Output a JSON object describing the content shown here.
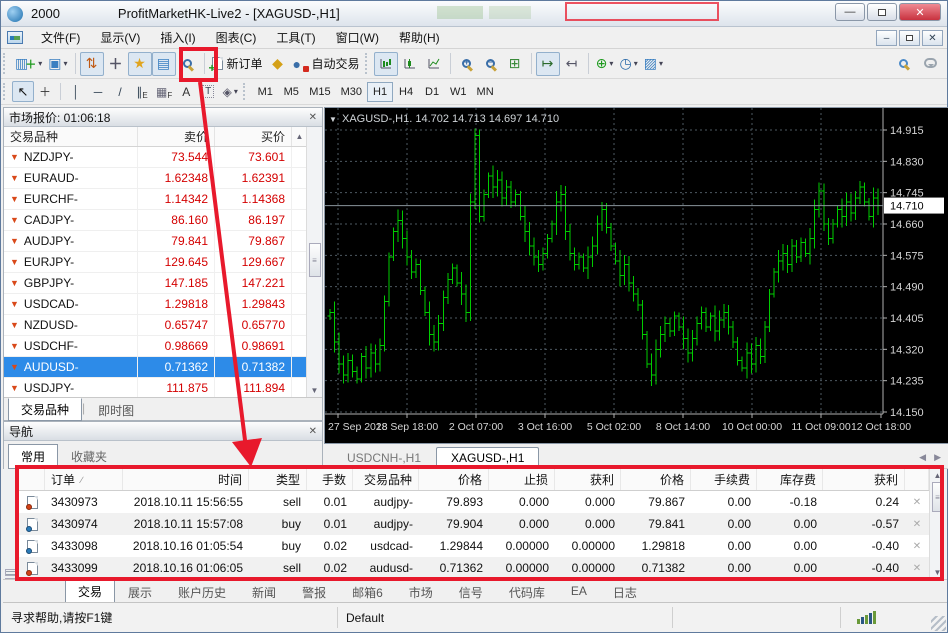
{
  "window": {
    "account": "2000",
    "title": "ProfitMarketHK-Live2 - [XAGUSD-,H1]"
  },
  "menu": {
    "items": [
      "文件(F)",
      "显示(V)",
      "插入(I)",
      "图表(C)",
      "工具(T)",
      "窗口(W)",
      "帮助(H)"
    ]
  },
  "toolbar": {
    "new_order_label": "新订单",
    "autotrading_label": "自动交易",
    "timeframes": [
      "M1",
      "M5",
      "M15",
      "M30",
      "H1",
      "H4",
      "D1",
      "W1",
      "MN"
    ],
    "active_timeframe": "H1"
  },
  "market_watch": {
    "title": "市场报价: 01:06:18",
    "columns": [
      "交易品种",
      "卖价",
      "买价"
    ],
    "rows": [
      {
        "symbol": "NZDJPY-",
        "bid": "73.544",
        "ask": "73.601"
      },
      {
        "symbol": "EURAUD-",
        "bid": "1.62348",
        "ask": "1.62391"
      },
      {
        "symbol": "EURCHF-",
        "bid": "1.14342",
        "ask": "1.14368"
      },
      {
        "symbol": "CADJPY-",
        "bid": "86.160",
        "ask": "86.197"
      },
      {
        "symbol": "AUDJPY-",
        "bid": "79.841",
        "ask": "79.867"
      },
      {
        "symbol": "EURJPY-",
        "bid": "129.645",
        "ask": "129.667"
      },
      {
        "symbol": "GBPJPY-",
        "bid": "147.185",
        "ask": "147.221"
      },
      {
        "symbol": "USDCAD-",
        "bid": "1.29818",
        "ask": "1.29843"
      },
      {
        "symbol": "NZDUSD-",
        "bid": "0.65747",
        "ask": "0.65770"
      },
      {
        "symbol": "USDCHF-",
        "bid": "0.98669",
        "ask": "0.98691"
      },
      {
        "symbol": "AUDUSD-",
        "bid": "0.71362",
        "ask": "0.71382",
        "selected": true
      },
      {
        "symbol": "USDJPY-",
        "bid": "111.875",
        "ask": "111.894"
      }
    ],
    "tabs": [
      "交易品种",
      "即时图"
    ],
    "active_tab": "交易品种"
  },
  "navigator": {
    "title": "导航",
    "tabs": [
      "常用",
      "收藏夹"
    ],
    "active_tab": "常用"
  },
  "chart_tabs": {
    "tabs": [
      "USDCNH-,H1",
      "XAGUSD-,H1"
    ],
    "active": "XAGUSD-,H1"
  },
  "chart_data": {
    "type": "bar",
    "symbol": "XAGUSD-",
    "timeframe": "H1",
    "header": "XAGUSD-,H1. 14.702 14.713 14.697 14.710",
    "current_bar": {
      "open": 14.702,
      "high": 14.713,
      "low": 14.697,
      "close": 14.71
    },
    "current_price": 14.71,
    "current_price_label": "14.710",
    "y_ticks": [
      14.915,
      14.83,
      14.745,
      14.66,
      14.575,
      14.49,
      14.405,
      14.32,
      14.235,
      14.15
    ],
    "ylim": [
      14.93,
      14.1
    ],
    "x_labels": [
      "27 Sep 2018",
      "28 Sep 18:00",
      "2 Oct 07:00",
      "3 Oct 16:00",
      "5 Oct 02:00",
      "8 Oct 14:00",
      "10 Oct 00:00",
      "11 Oct 09:00",
      "12 Oct 18:00"
    ],
    "grid": true,
    "legend": false,
    "closes": [
      14.42,
      14.34,
      14.28,
      14.25,
      14.29,
      14.26,
      14.24,
      14.3,
      14.27,
      14.31,
      14.28,
      14.33,
      14.45,
      14.57,
      14.64,
      14.67,
      14.62,
      14.57,
      14.53,
      14.55,
      14.48,
      14.42,
      14.36,
      14.34,
      14.39,
      14.46,
      14.51,
      14.54,
      14.5,
      14.47,
      14.42,
      14.72,
      14.9,
      14.68,
      14.74,
      14.79,
      14.76,
      14.78,
      14.73,
      14.76,
      14.72,
      14.74,
      14.68,
      14.64,
      14.6,
      14.57,
      14.55,
      14.58,
      14.62,
      14.66,
      14.72,
      14.74,
      14.64,
      14.58,
      14.55,
      14.57,
      14.54,
      14.57,
      14.6,
      14.66,
      14.7,
      14.65,
      14.6,
      14.56,
      14.52,
      14.55,
      14.5,
      14.47,
      14.44,
      14.36,
      14.28,
      14.25,
      14.32,
      14.36,
      14.39,
      14.37,
      14.41,
      14.38,
      14.35,
      14.31,
      14.35,
      14.39,
      14.42,
      14.38,
      14.41,
      14.37,
      14.4,
      14.42,
      14.38,
      14.34,
      14.29,
      14.27,
      14.31,
      14.28,
      14.33,
      14.3,
      14.38,
      14.47,
      14.53,
      14.56,
      14.58,
      14.55,
      14.6,
      14.57,
      14.61,
      14.58,
      14.62,
      14.7,
      14.75,
      14.66,
      14.62,
      14.66,
      14.7,
      14.68,
      14.72,
      14.69,
      14.73,
      14.76,
      14.72,
      14.68,
      14.73,
      14.71
    ],
    "colors": {
      "background": "#000000",
      "bars": "#00cc00",
      "grid": "#4e5a62",
      "current_price_line": "#8a949c",
      "axis_text": "#d4d4d4"
    }
  },
  "terminal": {
    "columns": [
      "订单",
      "时间",
      "类型",
      "手数",
      "交易品种",
      "价格",
      "止损",
      "获利",
      "价格",
      "手续费",
      "库存费",
      "获利"
    ],
    "sort_indicator": "∕",
    "orders": [
      {
        "id": "3430973",
        "time": "2018.10.11 15:56:55",
        "type": "sell",
        "lots": "0.01",
        "symbol": "audjpy-",
        "price": "79.893",
        "sl": "0.000",
        "tp": "0.000",
        "price2": "79.867",
        "commission": "0.00",
        "swap": "-0.18",
        "profit": "0.24"
      },
      {
        "id": "3430974",
        "time": "2018.10.11 15:57:08",
        "type": "buy",
        "lots": "0.01",
        "symbol": "audjpy-",
        "price": "79.904",
        "sl": "0.000",
        "tp": "0.000",
        "price2": "79.841",
        "commission": "0.00",
        "swap": "0.00",
        "profit": "-0.57"
      },
      {
        "id": "3433098",
        "time": "2018.10.16 01:05:54",
        "type": "buy",
        "lots": "0.02",
        "symbol": "usdcad-",
        "price": "1.29844",
        "sl": "0.00000",
        "tp": "0.00000",
        "price2": "1.29818",
        "commission": "0.00",
        "swap": "0.00",
        "profit": "-0.40"
      },
      {
        "id": "3433099",
        "time": "2018.10.16 01:06:05",
        "type": "sell",
        "lots": "0.02",
        "symbol": "audusd-",
        "price": "0.71362",
        "sl": "0.00000",
        "tp": "0.00000",
        "price2": "0.71382",
        "commission": "0.00",
        "swap": "0.00",
        "profit": "-0.40"
      }
    ],
    "tabs": [
      {
        "label": "交易",
        "active": true
      },
      {
        "label": "展示"
      },
      {
        "label": "账户历史"
      },
      {
        "label": "新闻"
      },
      {
        "label": "警报"
      },
      {
        "label": "邮箱",
        "badge": "6"
      },
      {
        "label": "市场"
      },
      {
        "label": "信号"
      },
      {
        "label": "代码库"
      },
      {
        "label": "EA"
      },
      {
        "label": "日志"
      }
    ]
  },
  "status_bar": {
    "help": "寻求帮助,请按F1键",
    "profile": "Default"
  },
  "annotation_color": "#e8192c"
}
